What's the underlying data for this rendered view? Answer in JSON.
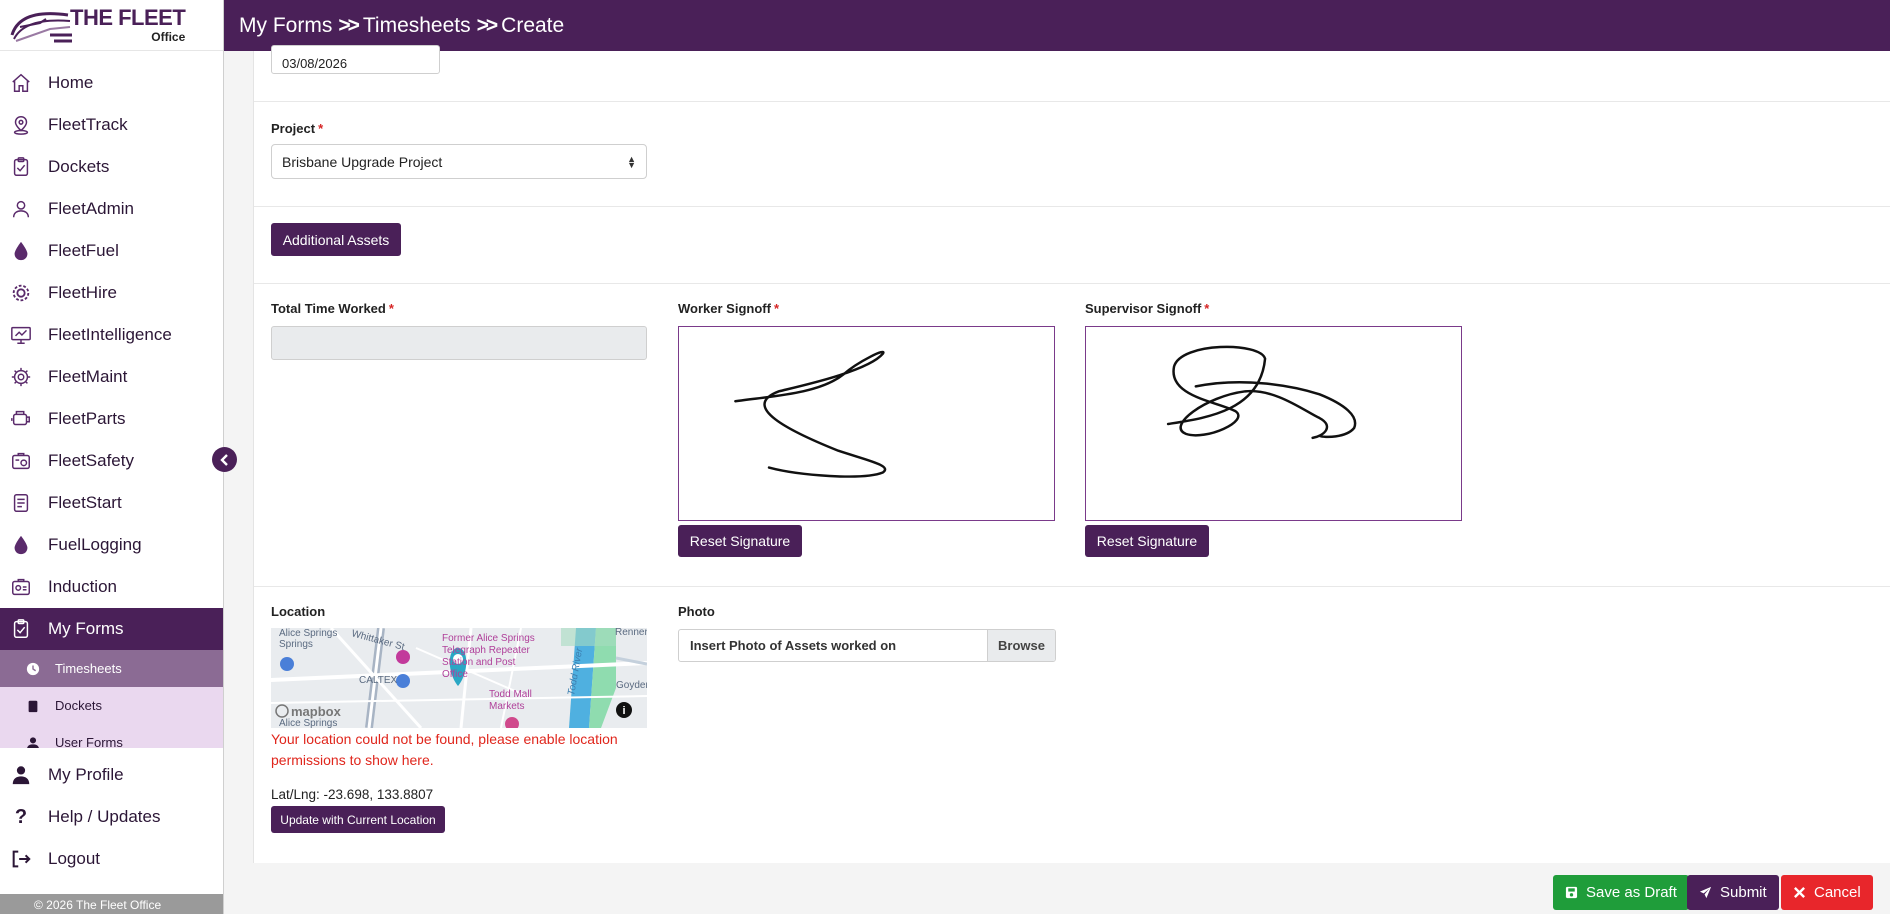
{
  "brand": {
    "title": "THE FLEET",
    "subtitle": "Office"
  },
  "header": {
    "crumbs": [
      "My Forms",
      "Timesheets",
      "Create"
    ]
  },
  "sidebar": {
    "items": [
      {
        "label": "Home",
        "icon": "home-icon"
      },
      {
        "label": "FleetTrack",
        "icon": "map-pin-icon"
      },
      {
        "label": "Dockets",
        "icon": "clipboard-check-icon"
      },
      {
        "label": "FleetAdmin",
        "icon": "user-admin-icon"
      },
      {
        "label": "FleetFuel",
        "icon": "fuel-drop-icon"
      },
      {
        "label": "FleetHire",
        "icon": "hire-gear-icon"
      },
      {
        "label": "FleetIntelligence",
        "icon": "monitor-chart-icon"
      },
      {
        "label": "FleetMaint",
        "icon": "maintenance-gear-icon"
      },
      {
        "label": "FleetParts",
        "icon": "engine-part-icon"
      },
      {
        "label": "FleetSafety",
        "icon": "safety-icon"
      },
      {
        "label": "FleetStart",
        "icon": "checklist-icon"
      },
      {
        "label": "FuelLogging",
        "icon": "fuel-drop-icon"
      },
      {
        "label": "Induction",
        "icon": "induction-icon"
      },
      {
        "label": "My Forms",
        "icon": "form-check-icon"
      }
    ],
    "subitems": [
      {
        "label": "Timesheets",
        "icon": "clock-icon"
      },
      {
        "label": "Dockets",
        "icon": "clipboard-icon"
      },
      {
        "label": "User Forms",
        "icon": "user-icon"
      }
    ],
    "bottom_items": [
      {
        "label": "My Profile",
        "icon": "user-icon"
      },
      {
        "label": "Help / Updates",
        "icon": "question-icon"
      },
      {
        "label": "Logout",
        "icon": "logout-icon"
      }
    ],
    "footer": "© 2026 The Fleet Office"
  },
  "form": {
    "date_value": "03/08/2026",
    "project_label": "Project",
    "project_value": "Brisbane Upgrade Project",
    "additional_assets": "Additional Assets",
    "total_time_label": "Total Time Worked",
    "total_time_value": "",
    "worker_signoff_label": "Worker Signoff",
    "supervisor_signoff_label": "Supervisor Signoff",
    "reset_signature": "Reset Signature",
    "location_label": "Location",
    "location_error": "Your location could not be found, please enable location permissions to show here.",
    "latlng": "Lat/Lng: -23.698, 133.8807",
    "update_location": "Update with Current Location",
    "photo_label": "Photo",
    "photo_placeholder": "Insert Photo of Assets worked on",
    "browse": "Browse",
    "required_mark": "*"
  },
  "map": {
    "labels": [
      "Alice Springs",
      "Whittaker St",
      "Former Alice Springs Telegraph Repeater Station and Post Office",
      "CALTEX",
      "Todd Mall Markets",
      "Todd River",
      "Renner",
      "Goyder",
      "mapbox",
      "Alice Springs"
    ]
  },
  "actions": {
    "save_draft": "Save as Draft",
    "submit": "Submit",
    "cancel": "Cancel"
  },
  "colors": {
    "brand_purple": "#4a2058",
    "submenu_bg": "#ead8ef",
    "submenu_active": "#8b6b94",
    "save_green": "#1f9d3a",
    "cancel_red": "#e8262b",
    "error_red": "#e0261c",
    "map_pin": "#2aa7c4"
  }
}
